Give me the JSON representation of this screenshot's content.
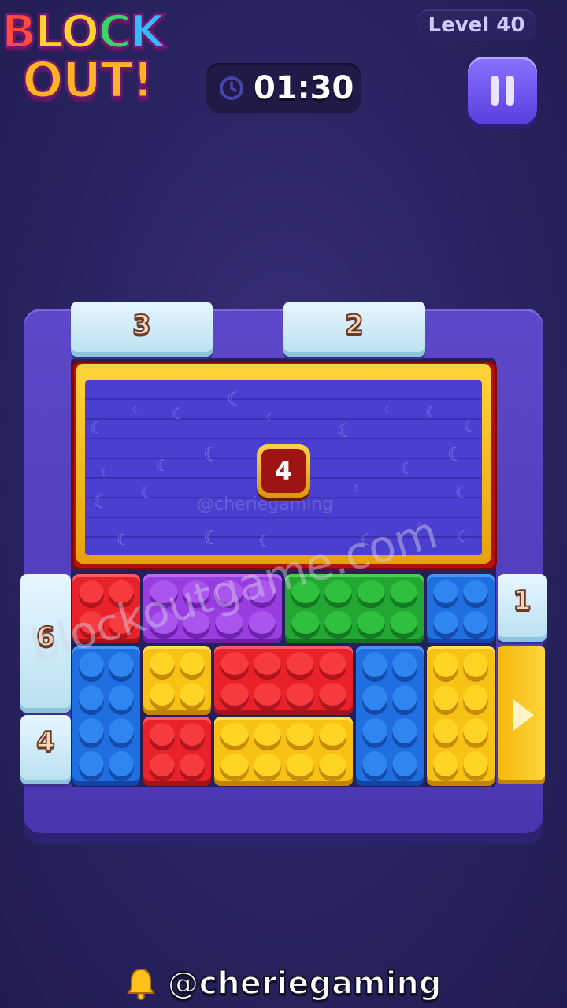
{
  "logo": {
    "line1": "BLOCK",
    "line2": "OUT!"
  },
  "level": {
    "label": "Level 40"
  },
  "timer": {
    "value": "01:30"
  },
  "gates": {
    "top_left": "3",
    "top_right": "2",
    "left_upper": "6",
    "left_lower": "4",
    "right_upper": "1"
  },
  "frozen_block": {
    "count": "4"
  },
  "watermark": {
    "main": "blockoutgame.com",
    "small": "@cheriegaming"
  },
  "footer": {
    "handle": "@cheriegaming"
  },
  "colors": {
    "red": "#e8212a",
    "purple": "#9a3de0",
    "green": "#22a832",
    "blue": "#1f6fe0",
    "yellow": "#f7c116",
    "background": "#2c2566"
  },
  "icons": {
    "timer": "clock-icon",
    "pause": "pause-icon",
    "exit": "arrow-right-icon",
    "footer": "bell-icon"
  }
}
